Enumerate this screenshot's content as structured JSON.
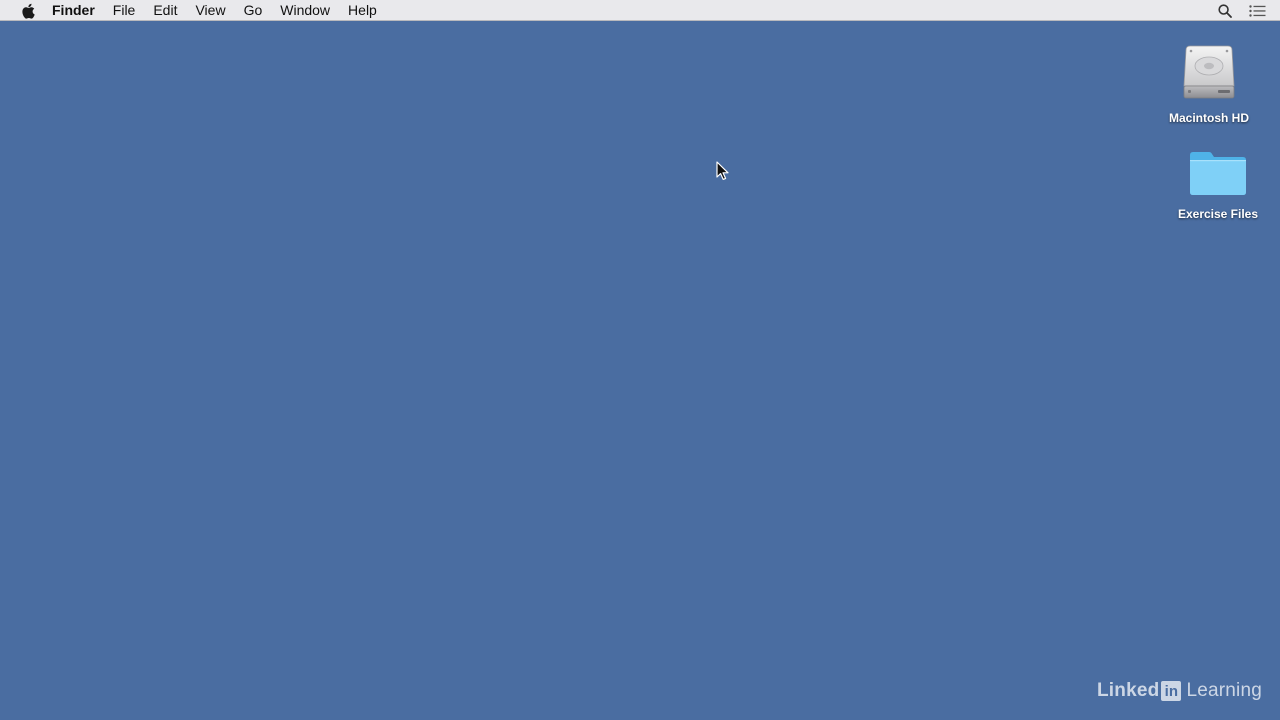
{
  "menubar": {
    "apple_icon": "apple-logo-icon",
    "app_name": "Finder",
    "items": [
      {
        "label": "File"
      },
      {
        "label": "Edit"
      },
      {
        "label": "View"
      },
      {
        "label": "Go"
      },
      {
        "label": "Window"
      },
      {
        "label": "Help"
      }
    ],
    "right_icons": [
      "spotlight-search-icon",
      "notification-center-icon"
    ]
  },
  "desktop": {
    "background_color": "#4a6da1",
    "icons": [
      {
        "label": "Macintosh HD",
        "icon": "hard-drive-icon"
      },
      {
        "label": "Exercise Files",
        "icon": "folder-icon"
      }
    ]
  },
  "watermark": {
    "linked": "Linked",
    "in": "in",
    "learning": "Learning"
  }
}
